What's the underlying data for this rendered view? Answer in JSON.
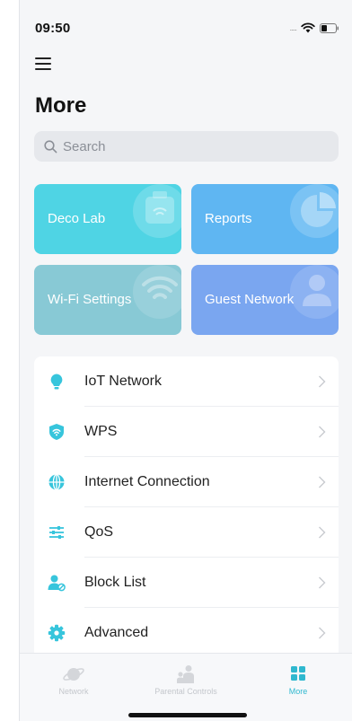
{
  "status": {
    "time": "09:50",
    "dots": "....."
  },
  "page": {
    "title": "More"
  },
  "search": {
    "placeholder": "Search"
  },
  "tiles": [
    {
      "label": "Deco Lab",
      "icon": "lab-icon"
    },
    {
      "label": "Reports",
      "icon": "pie-chart-icon"
    },
    {
      "label": "Wi-Fi Settings",
      "icon": "wifi-icon"
    },
    {
      "label": "Guest Network",
      "icon": "guest-icon"
    }
  ],
  "menu": [
    {
      "label": "IoT Network",
      "icon": "lightbulb-icon"
    },
    {
      "label": "WPS",
      "icon": "wps-shield-icon"
    },
    {
      "label": "Internet Connection",
      "icon": "globe-icon"
    },
    {
      "label": "QoS",
      "icon": "sliders-icon"
    },
    {
      "label": "Block List",
      "icon": "block-user-icon"
    },
    {
      "label": "Advanced",
      "icon": "gear-icon"
    }
  ],
  "tabbar": [
    {
      "label": "Network",
      "icon": "planet-icon"
    },
    {
      "label": "Parental Controls",
      "icon": "family-icon"
    },
    {
      "label": "More",
      "icon": "grid-icon"
    }
  ],
  "colors": {
    "accent": "#2fb8cf",
    "tile_deco_lab": "#4fd4e4",
    "tile_reports": "#5fb6f2",
    "tile_wifi": "#88c9d5",
    "tile_guest": "#7aa6f0"
  }
}
